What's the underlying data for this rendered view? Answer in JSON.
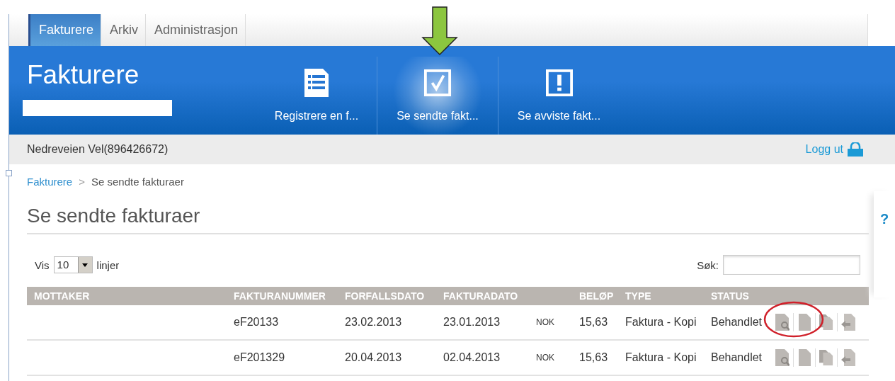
{
  "tabs": [
    {
      "label": "Fakturere",
      "selected": true
    },
    {
      "label": "Arkiv",
      "selected": false
    },
    {
      "label": "Administrasjon",
      "selected": false
    }
  ],
  "header": {
    "title": "Fakturere",
    "nav": [
      {
        "label": "Registrere en f...",
        "kind": "list",
        "selected": false
      },
      {
        "label": "Se sendte fakt...",
        "kind": "check",
        "selected": true
      },
      {
        "label": "Se avviste fakt...",
        "kind": "warning",
        "selected": false
      }
    ]
  },
  "user_bar": {
    "user": "Nedreveien Vel(896426672)",
    "logout": "Logg ut"
  },
  "breadcrumb": {
    "link": "Fakturere",
    "separator": ">",
    "current": "Se sendte fakturaer"
  },
  "page_title": "Se sendte fakturaer",
  "help_label": "?",
  "controls": {
    "show_label": "Vis",
    "page_size": "10",
    "lines_label": "linjer",
    "search_label": "Søk:"
  },
  "table": {
    "columns": [
      "MOTTAKER",
      "FAKTURANUMMER",
      "FORFALLSDATO",
      "FAKTURADATO",
      "",
      "BELØP",
      "TYPE",
      "STATUS",
      ""
    ],
    "rows": [
      {
        "invoice_number": "eF20133",
        "due_date": "23.02.2013",
        "invoice_date": "23.01.2013",
        "currency": "NOK",
        "amount": "15,63",
        "type": "Faktura - Kopi",
        "status": "Behandlet",
        "highlighted": true
      },
      {
        "invoice_number": "eF201329",
        "due_date": "20.04.2013",
        "invoice_date": "02.04.2013",
        "currency": "NOK",
        "amount": "15,63",
        "type": "Faktura - Kopi",
        "status": "Behandlet",
        "highlighted": false
      }
    ]
  }
}
